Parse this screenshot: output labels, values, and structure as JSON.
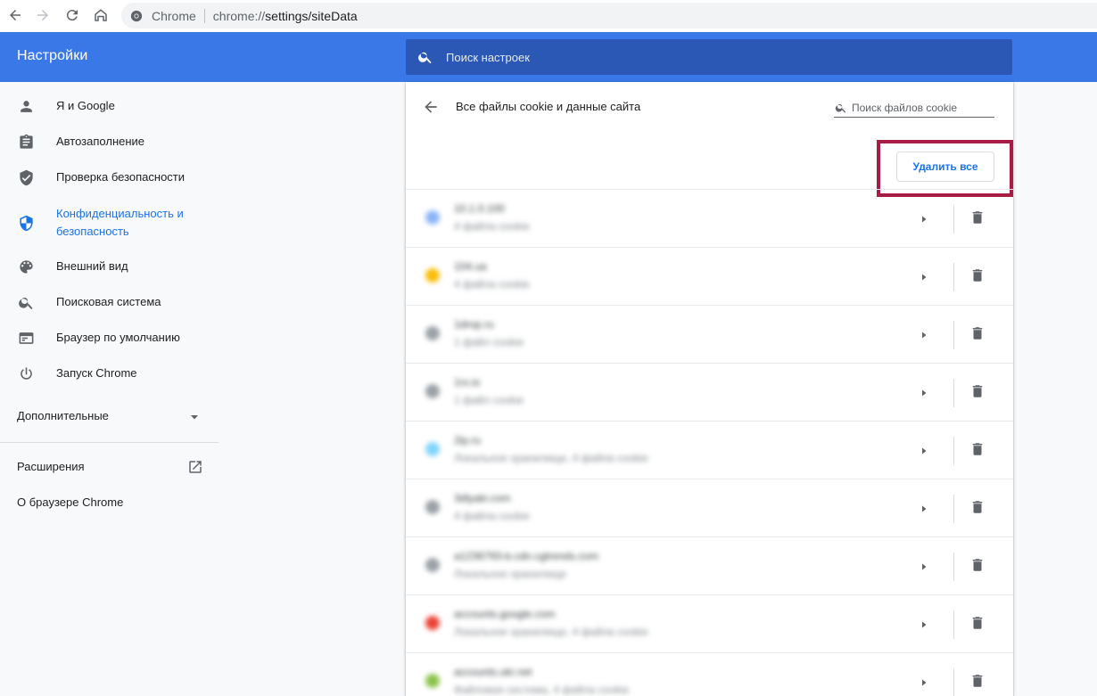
{
  "browser": {
    "site_name": "Chrome",
    "url_scheme": "chrome://",
    "url_rest": "settings/siteData"
  },
  "header": {
    "title": "Настройки",
    "search_placeholder": "Поиск настроек"
  },
  "sidebar": {
    "items": [
      {
        "label": "Я и Google",
        "icon": "person-icon"
      },
      {
        "label": "Автозаполнение",
        "icon": "clipboard-icon"
      },
      {
        "label": "Проверка безопасности",
        "icon": "shield-check-icon"
      },
      {
        "label_line1": "Конфиденциальность и",
        "label_line2": "безопасность",
        "icon": "privacy-shield-icon",
        "active": true
      },
      {
        "label": "Внешний вид",
        "icon": "palette-icon"
      },
      {
        "label": "Поисковая система",
        "icon": "search-icon"
      },
      {
        "label": "Браузер по умолчанию",
        "icon": "browser-window-icon"
      },
      {
        "label": "Запуск Chrome",
        "icon": "power-icon"
      }
    ],
    "advanced_label": "Дополнительные",
    "extensions_label": "Расширения",
    "about_label": "О браузере Chrome"
  },
  "main": {
    "title": "Все файлы cookie и данные сайта",
    "cookie_search_placeholder": "Поиск файлов cookie",
    "remove_all_label": "Удалить все",
    "sites": [
      {
        "site": "10.1.0.100",
        "detail": "4 файла cookie",
        "favicon_color": "#8ab4f8"
      },
      {
        "site": "104.ua",
        "detail": "4 файла cookie",
        "favicon_color": "#fbbc04"
      },
      {
        "site": "1drop.ru",
        "detail": "1 файл cookie",
        "favicon_color": "#9aa0a6"
      },
      {
        "site": "1rx.io",
        "detail": "1 файл cookie",
        "favicon_color": "#9aa0a6"
      },
      {
        "site": "2ip.ru",
        "detail": "Локальное хранилище, 4 файла cookie",
        "favicon_color": "#81d4fa"
      },
      {
        "site": "3dlyaki.com",
        "detail": "4 файла cookie",
        "favicon_color": "#9aa0a6"
      },
      {
        "site": "a1236793-b.cdn.cgtrends.com",
        "detail": "Локальное хранилище",
        "favicon_color": "#9aa0a6"
      },
      {
        "site": "accounts.google.com",
        "detail": "Локальное хранилище, 4 файла cookie",
        "favicon_color": "#ea4335"
      },
      {
        "site": "accounts.ukr.net",
        "detail": "Файловая система, 4 файла cookie",
        "favicon_color": "#8bc34a"
      }
    ]
  },
  "colors": {
    "header_blue": "#3b78e7",
    "search_blue": "#2a58b4",
    "accent": "#1a73e8",
    "highlight": "#a61c44"
  }
}
